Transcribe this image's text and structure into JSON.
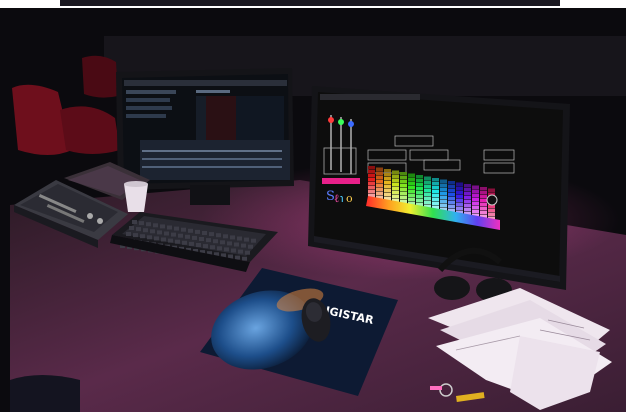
{
  "scene": {
    "mousepad_brand": "DIGISTAR",
    "colors": {
      "room_dark": "#0b0a0e",
      "desk_magenta": "#5a2a4a",
      "seat_red": "#6e0f1c",
      "monitor_bezel": "#141418",
      "palette_bg": "#0d0d0d",
      "brightness_bar": "#e8208a",
      "paper": "#efe6ee",
      "mousepad_blue": "#1d4e8a"
    }
  }
}
